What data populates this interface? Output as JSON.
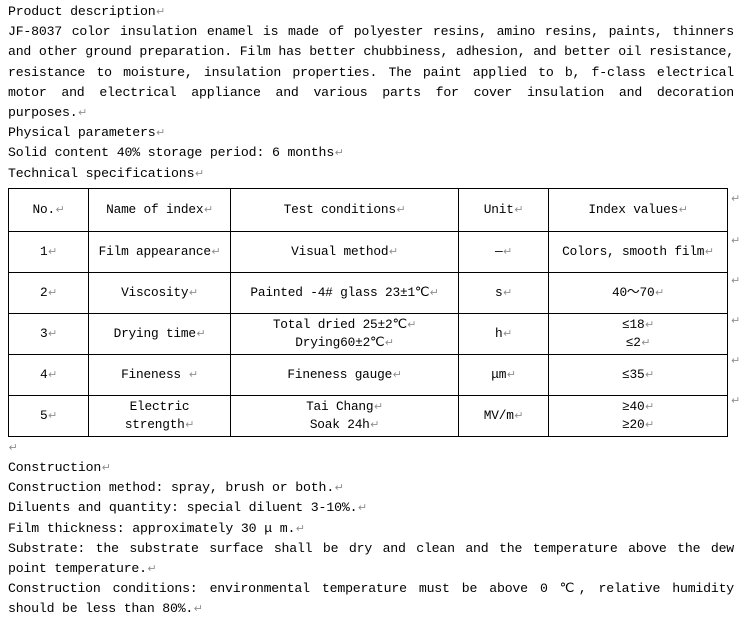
{
  "document": {
    "pilcrow": "↵",
    "intro": {
      "heading": "Product description",
      "paragraph": "JF-8037 color insulation enamel is made of polyester resins, amino resins, paints, thinners and other ground preparation. Film has better chubbiness, adhesion, and better oil resistance, resistance to moisture, insulation properties. The paint applied to b, f-class electrical motor and electrical appliance and various parts for cover insulation and decoration purposes.",
      "physical_heading": "Physical parameters",
      "physical_line": "Solid content 40% storage period: 6 months",
      "tech_heading": "Technical specifications"
    },
    "table": {
      "headers": [
        "No.",
        "Name of index",
        "Test conditions",
        "Unit",
        "Index values"
      ],
      "rows": [
        {
          "no": "1",
          "name": "Film appearance",
          "conditions": [
            "Visual method"
          ],
          "unit": "—",
          "values": [
            "Colors, smooth film"
          ]
        },
        {
          "no": "2",
          "name": "Viscosity",
          "conditions": [
            "Painted -4# glass 23±1℃"
          ],
          "unit": "s",
          "values": [
            "40～70"
          ]
        },
        {
          "no": "3",
          "name": "Drying time",
          "conditions": [
            "Total dried 25±2℃",
            "Drying60±2℃"
          ],
          "unit": "h",
          "values": [
            "≤18",
            "≤2"
          ]
        },
        {
          "no": "4",
          "name": "Fineness ",
          "conditions": [
            "Fineness gauge"
          ],
          "unit": "μm",
          "values": [
            "≤35"
          ]
        },
        {
          "no": "5",
          "name": [
            "Electric",
            "strength"
          ],
          "conditions": [
            "Tai Chang",
            "Soak 24h"
          ],
          "unit": "MV/m",
          "values": [
            "≥40",
            "≥20"
          ]
        }
      ]
    },
    "construction": {
      "heading": "Construction",
      "method": "Construction method: spray, brush or both.",
      "diluents": "Diluents and quantity: special diluent 3-10%.",
      "thickness": "Film thickness: approximately 30 μ m.",
      "substrate": "Substrate: the substrate surface shall be dry and clean and the temperature above the dew point temperature.",
      "conditions": "Construction conditions: environmental temperature must be above 0 ℃, relative humidity should be less than 80%."
    }
  }
}
